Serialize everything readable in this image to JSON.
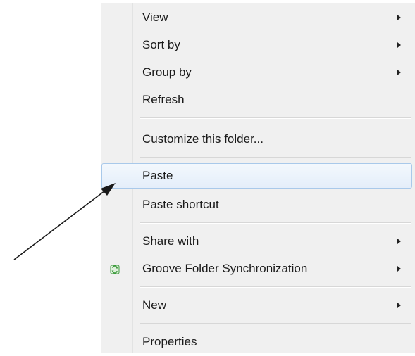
{
  "context_menu": {
    "items": [
      {
        "label": "View",
        "submenu": true
      },
      {
        "label": "Sort by",
        "submenu": true
      },
      {
        "label": "Group by",
        "submenu": true
      },
      {
        "label": "Refresh",
        "submenu": false
      },
      {
        "label": "Customize this folder...",
        "submenu": false
      },
      {
        "label": "Paste",
        "submenu": false,
        "highlighted": true
      },
      {
        "label": "Paste shortcut",
        "submenu": false
      },
      {
        "label": "Share with",
        "submenu": true
      },
      {
        "label": "Groove Folder Synchronization",
        "submenu": true,
        "icon": "groove-sync-icon"
      },
      {
        "label": "New",
        "submenu": true
      },
      {
        "label": "Properties",
        "submenu": false
      }
    ]
  },
  "colors": {
    "menu_background": "#f0f0f0",
    "highlight_border": "#a9c9ea",
    "highlight_fill": "#e4eefa",
    "pointer_arrow": "#1a1a1a",
    "groove_icon": "#3c9a3c"
  },
  "annotation": {
    "icon": "pointer-arrow-icon",
    "target": "Paste"
  }
}
